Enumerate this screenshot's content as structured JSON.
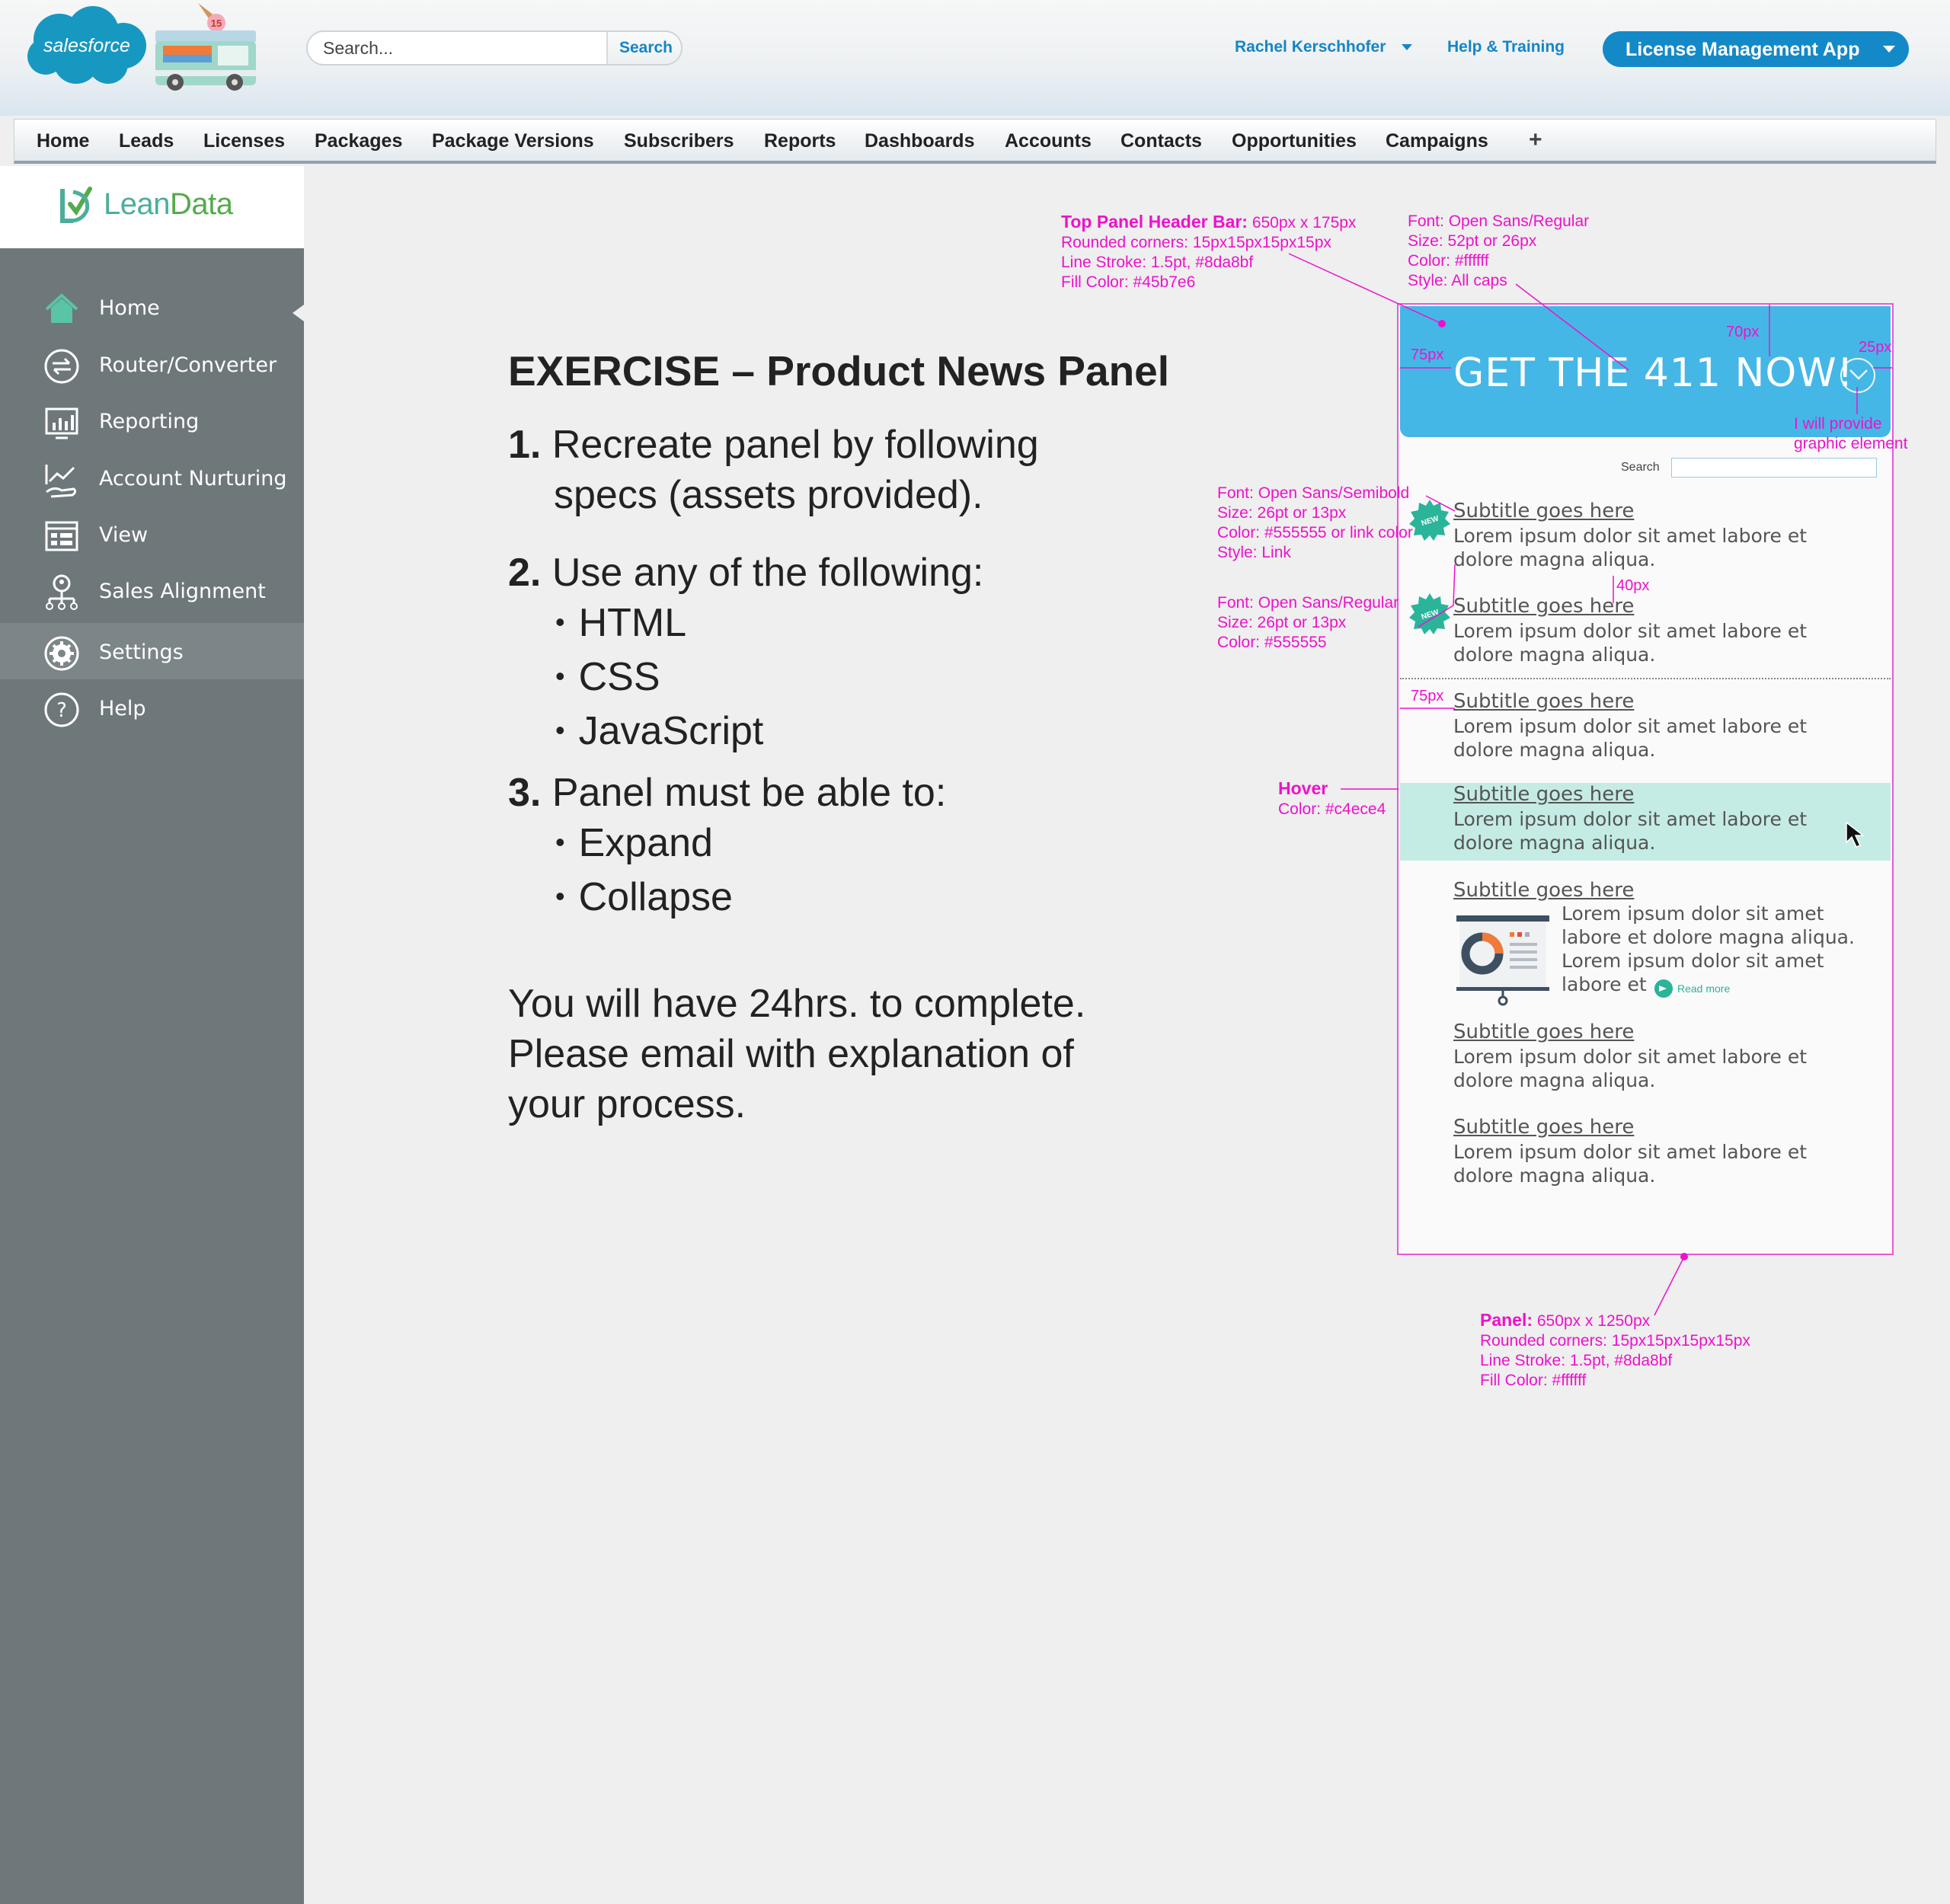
{
  "header": {
    "search_placeholder": "Search...",
    "search_button": "Search",
    "user_name": "Rachel Kerschhofer",
    "help_link": "Help & Training",
    "app_button": "License Management App",
    "logo_text": "salesforce",
    "truck_badge": "15"
  },
  "tabs": [
    "Home",
    "Leads",
    "Licenses",
    "Packages",
    "Package Versions",
    "Subscribers",
    "Reports",
    "Dashboards",
    "Accounts",
    "Contacts",
    "Opportunities",
    "Campaigns"
  ],
  "tab_add": "+",
  "leandata": {
    "logo_part1": "Lean",
    "logo_part2": "Data"
  },
  "sidebar": {
    "items": [
      {
        "label": "Home",
        "icon": "home-icon"
      },
      {
        "label": "Router/Converter",
        "icon": "router-icon"
      },
      {
        "label": "Reporting",
        "icon": "reporting-icon"
      },
      {
        "label": "Account Nurturing",
        "icon": "nurturing-icon"
      },
      {
        "label": "View",
        "icon": "view-icon"
      },
      {
        "label": "Sales Alignment",
        "icon": "sales-alignment-icon"
      },
      {
        "label": "Settings",
        "icon": "settings-icon"
      },
      {
        "label": "Help",
        "icon": "help-icon"
      }
    ],
    "active_item": "Home",
    "highlighted_item": "Settings"
  },
  "exercise": {
    "title": "EXERCISE – Product News Panel",
    "step1_num": "1.",
    "step1_line1": "Recreate panel by following",
    "step1_line2": "specs (assets provided).",
    "step2_num": "2.",
    "step2_line1": "Use any of the following:",
    "step2_bullets": [
      "HTML",
      "CSS",
      "JavaScript"
    ],
    "step3_num": "3.",
    "step3_line1": "Panel must be able to:",
    "step3_bullets": [
      "Expand",
      "Collapse"
    ],
    "footer_line1": "You will have 24hrs. to complete.",
    "footer_line2": "Please email with explanation of",
    "footer_line3": "your process."
  },
  "annotations": {
    "header_bar_title": "Top Panel Header Bar:",
    "header_bar_size": "650px x 175px",
    "header_bar_corners": "Rounded corners: 15px15px15px15px",
    "header_bar_stroke": "Line Stroke: 1.5pt, #8da8bf",
    "header_bar_fill": "Fill Color: #45b7e6",
    "title_font": "Font: Open Sans/Regular",
    "title_size": "Size: 52pt or 26px",
    "title_color": "Color: #ffffff",
    "title_style": "Style: All caps",
    "subtitle_font": "Font: Open Sans/Semibold",
    "subtitle_size": "Size: 26pt or 13px",
    "subtitle_color": "Color: #555555 or link color",
    "subtitle_style": "Style: Link",
    "body_font": "Font: Open Sans/Regular",
    "body_size": "Size: 26pt or 13px",
    "body_color": "Color: #555555",
    "hover_title": "Hover",
    "hover_color": "Color: #c4ece4",
    "graphic_note_1": "I will provide",
    "graphic_note_2": "graphic element",
    "panel_title": "Panel:",
    "panel_size": "650px x 1250px",
    "panel_corners": "Rounded corners: 15px15px15px15px",
    "panel_stroke": "Line Stroke: 1.5pt, #8da8bf",
    "panel_fill": "Fill Color: #ffffff",
    "dim_75_header": "75px",
    "dim_70": "70px",
    "dim_25": "25px",
    "dim_40": "40px",
    "dim_75_item": "75px"
  },
  "panel": {
    "title": "GET THE 411 NOW!",
    "search_label": "Search",
    "search_value": "",
    "new_badge": "NEW",
    "items": [
      {
        "subtitle": "Subtitle goes here",
        "line1": "Lorem ipsum dolor sit amet labore et",
        "line2": "dolore magna aliqua."
      },
      {
        "subtitle": "Subtitle goes here",
        "line1": "Lorem ipsum dolor sit amet labore et",
        "line2": "dolore magna aliqua."
      },
      {
        "subtitle": "Subtitle goes here",
        "line1": "Lorem ipsum dolor sit amet labore et",
        "line2": "dolore magna aliqua."
      },
      {
        "subtitle": "Subtitle goes here",
        "line1": "Lorem ipsum dolor sit amet labore et",
        "line2": "dolore magna aliqua."
      },
      {
        "subtitle": "Subtitle goes here",
        "line1": "Lorem ipsum dolor sit amet labore et",
        "line2": "dolore magna aliqua."
      },
      {
        "subtitle": "Subtitle goes here",
        "line1": "Lorem ipsum dolor sit amet labore et",
        "line2": "dolore magna aliqua."
      }
    ],
    "feature_item": {
      "subtitle": "Subtitle goes here",
      "line1": "Lorem ipsum dolor sit amet",
      "line2": "labore et dolore magna aliqua.",
      "line3": "Lorem ipsum dolor sit amet",
      "line4": "labore et ...",
      "read_more": "Read more"
    }
  },
  "colors": {
    "header_fill": "#45b7e6",
    "hover": "#c4ece4",
    "text": "#555555",
    "annotation": "#ee11cc",
    "sidebar": "#6e777a",
    "salesforce_blue": "#1798c1",
    "accent_link": "#1585c7"
  }
}
